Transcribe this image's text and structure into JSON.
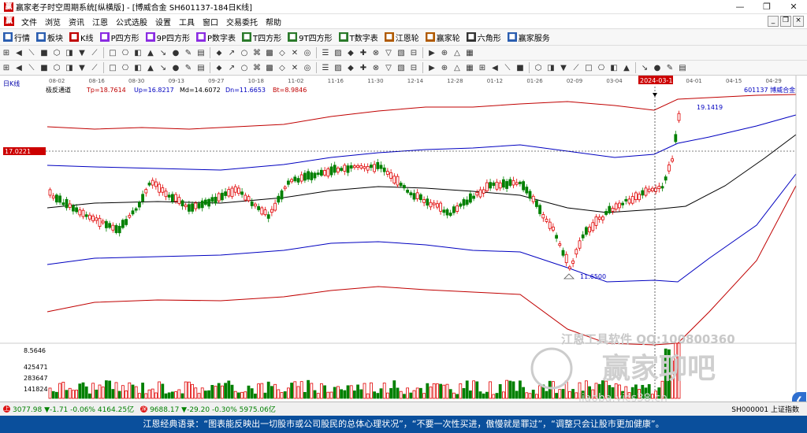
{
  "window": {
    "title": "赢家老子时空周期系统[纵横版] - [博威合金  SH601137-184日K线]",
    "controls": [
      "—",
      "❐",
      "✕"
    ]
  },
  "menu": {
    "items": [
      "文件",
      "浏览",
      "资讯",
      "江恩",
      "公式选股",
      "设置",
      "工具",
      "窗口",
      "交易委托",
      "帮助"
    ],
    "mdi": [
      "_",
      "❐",
      "×"
    ]
  },
  "toolbar1": {
    "items": [
      {
        "label": "行情",
        "icon": "grid-icon",
        "color": "#2a5db0"
      },
      {
        "label": "板块",
        "icon": "blocks-icon",
        "color": "#2a5db0"
      },
      {
        "label": "K线",
        "icon": "kline-icon",
        "color": "#c00000"
      },
      {
        "label": "P四方形",
        "icon": "p-square-icon",
        "color": "#8a2be2"
      },
      {
        "label": "9P四方形",
        "icon": "9p-square-icon",
        "color": "#8a2be2"
      },
      {
        "label": "P数字表",
        "icon": "p-table-icon",
        "color": "#8a2be2"
      },
      {
        "label": "T四方形",
        "icon": "t-square-icon",
        "color": "#2a7a2a"
      },
      {
        "label": "9T四方形",
        "icon": "9t-square-icon",
        "color": "#2a7a2a"
      },
      {
        "label": "T数字表",
        "icon": "t-table-icon",
        "color": "#2a7a2a"
      },
      {
        "label": "江恩轮",
        "icon": "gann-wheel-icon",
        "color": "#b05a00"
      },
      {
        "label": "赢家轮",
        "icon": "winner-wheel-icon",
        "color": "#b05a00"
      },
      {
        "label": "六角形",
        "icon": "hexagon-icon",
        "color": "#333333"
      },
      {
        "label": "赢家服务",
        "icon": "service-icon",
        "color": "#2a5db0"
      }
    ]
  },
  "toolbar2": {
    "count": 36
  },
  "toolbar3": {
    "count": 52
  },
  "chart": {
    "period_label": "日K线",
    "indicator_name": "极反通道",
    "tp": "Tp=18.7614",
    "up": "Up=16.8217",
    "md": "Md=14.6072",
    "dn": "Dn=11.6653",
    "bt": "Bt=8.9846",
    "stock_label": "601137  博威合金",
    "price_tag": "17.0221",
    "high_label": "19.1419",
    "low_label": "11.6500",
    "date_badge": "2024-03-13",
    "dates": [
      "08-02",
      "08-16",
      "08-30",
      "09-13",
      "09-27",
      "10-18",
      "11-02",
      "11-16",
      "11-30",
      "12-14",
      "12-28",
      "01-12",
      "01-26",
      "02-09",
      "03-04",
      "2024-03-13",
      "04-01",
      "04-15",
      "04-29"
    ],
    "volume_labels": [
      "8.5646",
      "425471",
      "283647",
      "141824"
    ],
    "watermark_text": "江恩工具软件  QQ:100800360",
    "watermark_logo": "赢家聊吧",
    "watermark_url": "liaoba.yjcs38.cn",
    "colors": {
      "up": "#e00000",
      "down": "#008000",
      "upper1": "#c00000",
      "upper2": "#0000c0",
      "mid": "#000000",
      "lower1": "#0000c0",
      "lower2": "#c00000"
    }
  },
  "infobar": {
    "sh_index": "3077.98  ▼-1.71  -0.06%  4164.25亿",
    "sz_index": "9688.17  ▼-29.20  -0.30%  5975.06亿",
    "right_label": "SH000001 上证指数"
  },
  "quote": "江恩经典语录：“图表能反映出一切股市或公司股民的总体心理状况”，“不要一次性买进，傲慢就是罪过”，“调整只会让股市更加健康”。"
}
